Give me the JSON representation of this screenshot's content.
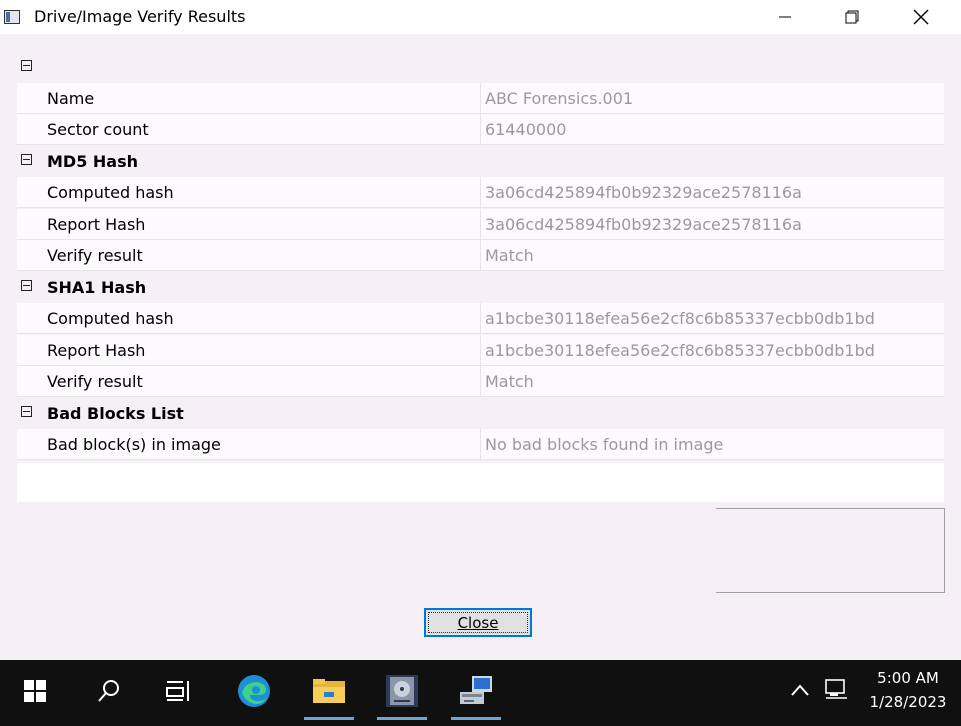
{
  "window": {
    "title": "Drive/Image Verify Results"
  },
  "grid": {
    "general_rows": [
      {
        "name": "Name",
        "value": "ABC Forensics.001"
      },
      {
        "name": "Sector count",
        "value": "61440000"
      }
    ],
    "md5": {
      "label": "MD5 Hash",
      "rows": [
        {
          "name": "Computed hash",
          "value": "3a06cd425894fb0b92329ace2578116a"
        },
        {
          "name": "Report Hash",
          "value": "3a06cd425894fb0b92329ace2578116a"
        },
        {
          "name": "Verify result",
          "value": "Match"
        }
      ]
    },
    "sha1": {
      "label": "SHA1 Hash",
      "rows": [
        {
          "name": "Computed hash",
          "value": "a1bcbe30118efea56e2cf8c6b85337ecbb0db1bd"
        },
        {
          "name": "Report Hash",
          "value": "a1bcbe30118efea56e2cf8c6b85337ecbb0db1bd"
        },
        {
          "name": "Verify result",
          "value": "Match"
        }
      ]
    },
    "bad_blocks": {
      "label": "Bad Blocks List",
      "rows": [
        {
          "name": "Bad block(s) in image",
          "value": "No bad blocks found in image"
        }
      ]
    }
  },
  "buttons": {
    "close_label": "Close"
  },
  "taskbar": {
    "clock_time": "5:00 AM",
    "clock_date": "1/28/2023",
    "items": [
      "start-icon",
      "search-icon",
      "task-view-icon",
      "edge-icon",
      "file-explorer-icon",
      "disk-imager-icon",
      "network-setup-icon"
    ]
  },
  "colors": {
    "accent": "#0078d7",
    "value_text": "#9a9a9a",
    "taskbar": "#101010"
  }
}
